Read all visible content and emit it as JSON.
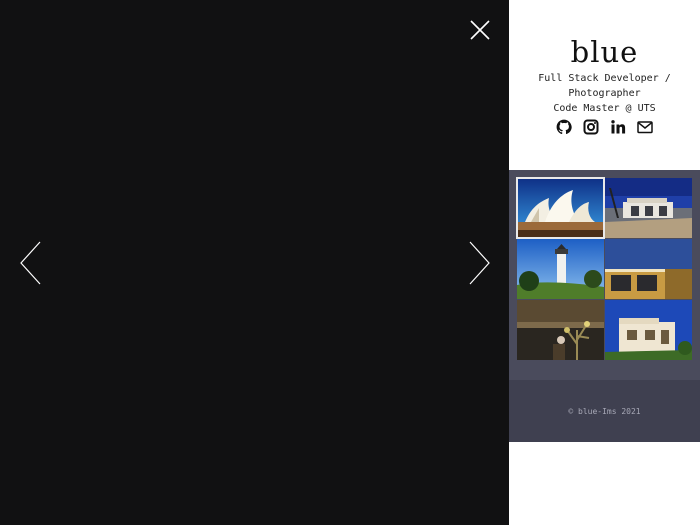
{
  "profile": {
    "title": "blue",
    "bio_line1": "Full Stack Developer /",
    "bio_line2": "Photographer",
    "bio_line3": "Code Master @ UTS"
  },
  "socials": [
    {
      "icon": "github-icon"
    },
    {
      "icon": "instagram-icon"
    },
    {
      "icon": "linkedin-icon"
    },
    {
      "icon": "mail-icon"
    }
  ],
  "gallery": {
    "thumbnails": [
      {
        "subject": "opera-house",
        "active": true
      },
      {
        "subject": "beach-pavilion",
        "active": false
      },
      {
        "subject": "lighthouse",
        "active": false
      },
      {
        "subject": "building-corner",
        "active": false
      },
      {
        "subject": "cafe-plant",
        "active": false
      },
      {
        "subject": "white-house",
        "active": false
      }
    ]
  },
  "footer": {
    "copyright": "© blue-Ims 2021"
  },
  "viewer": {
    "background": "#111112"
  }
}
